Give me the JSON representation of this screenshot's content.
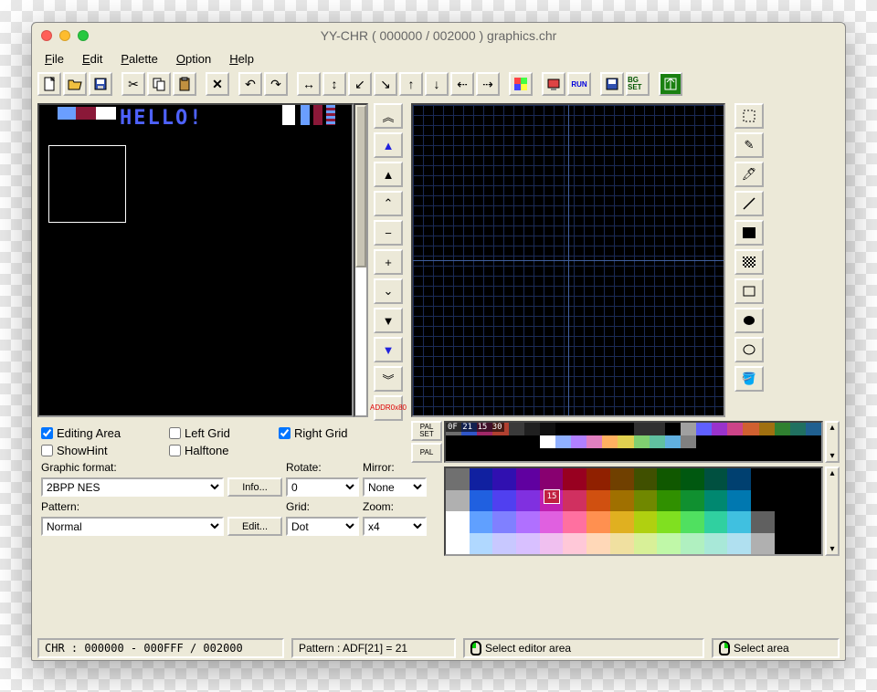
{
  "title": "YY-CHR ( 000000 / 002000 ) graphics.chr",
  "menu": {
    "file": "File",
    "edit": "Edit",
    "palette": "Palette",
    "option": "Option",
    "help": "Help"
  },
  "toolbar": {
    "new": "new",
    "open": "open",
    "save": "save",
    "cut": "cut",
    "copy": "copy",
    "paste": "paste",
    "delete": "delete",
    "undo": "undo",
    "redo": "redo",
    "fliph": "fliph",
    "flipv": "flipv",
    "rotl": "rotl",
    "rotr": "rotr",
    "shu": "shift-up",
    "shd": "shift-down",
    "shl": "shift-left",
    "shr": "shift-right",
    "pal": "palette",
    "emu": "emulator",
    "run": "RUN",
    "save2": "save",
    "bgset": "BG SET",
    "exit": "exit"
  },
  "nav": {
    "addr_label": "ADDR",
    "addr_value": "0x80"
  },
  "chr": {
    "hello": "HELLO!"
  },
  "checks": {
    "editing_area": "Editing Area",
    "left_grid": "Left Grid",
    "right_grid": "Right Grid",
    "showhint": "ShowHint",
    "halftone": "Halftone"
  },
  "opts": {
    "graphic_format_label": "Graphic format:",
    "graphic_format_value": "2BPP NES",
    "info_btn": "Info...",
    "rotate_label": "Rotate:",
    "rotate_value": "0",
    "mirror_label": "Mirror:",
    "mirror_value": "None",
    "pattern_label": "Pattern:",
    "pattern_value": "Normal",
    "edit_btn": "Edit...",
    "grid_label": "Grid:",
    "grid_value": "Dot",
    "zoom_label": "Zoom:",
    "zoom_value": "x4"
  },
  "pal": {
    "set": "PAL SET",
    "pal": "PAL",
    "nums": "0F 21 15 30",
    "marker": "15"
  },
  "palette_colors": [
    "#6d6d6d",
    "#3056c8",
    "#a02868",
    "#b04030",
    "#3a3a3a",
    "#202020",
    "#101010",
    "#000",
    "#000",
    "#000",
    "#000",
    "#000",
    "#303030",
    "#303030",
    "#000",
    "#a0a0a0",
    "#6060ff",
    "#9933cc",
    "#cc4488",
    "#d06030",
    "#a07010",
    "#308030",
    "#207060",
    "#206090",
    "#000",
    "#000",
    "#000",
    "#000",
    "#000",
    "#000",
    "#fff",
    "#90b0ff",
    "#b080ff",
    "#e080c0",
    "#ffb060",
    "#e0d050",
    "#80d070",
    "#60c0a0",
    "#60b0e0",
    "#808080",
    "#000",
    "#000",
    "#000",
    "#000",
    "#000",
    "#000",
    "#000",
    "#000",
    "#000",
    "#000",
    "#000",
    "#000",
    "#000",
    "#000",
    "#000",
    "#000",
    "#000",
    "#000",
    "#000",
    "#000",
    "#000",
    "#000",
    "#000",
    "#000",
    "#000",
    "#000",
    "#000",
    "#000",
    "#000",
    "#000",
    "#000",
    "#000"
  ],
  "gradient_colors": [
    "#707070",
    "#1020a0",
    "#3010b0",
    "#6000a0",
    "#880070",
    "#980020",
    "#902000",
    "#704000",
    "#405000",
    "#105800",
    "#005810",
    "#005040",
    "#004070",
    "#000",
    "#000",
    "#000",
    "#b0b0b0",
    "#2060e0",
    "#5040f0",
    "#8030e0",
    "#c020b0",
    "#d03060",
    "#d05010",
    "#a07000",
    "#708800",
    "#309000",
    "#109030",
    "#008870",
    "#0078b0",
    "#000",
    "#000",
    "#000",
    "#fff",
    "#60a0ff",
    "#8080ff",
    "#b070ff",
    "#e060e0",
    "#ff70a0",
    "#ff9050",
    "#e0b020",
    "#b0d010",
    "#80e020",
    "#50e060",
    "#30d0a0",
    "#40c0e0",
    "#606060",
    "#000",
    "#000",
    "#fff",
    "#b0d8ff",
    "#c8c8ff",
    "#d8c0ff",
    "#f0c0f0",
    "#ffc8d8",
    "#ffd8b8",
    "#f0e0a0",
    "#d8f098",
    "#c0f8a8",
    "#b0f0c0",
    "#a8e8d8",
    "#b0e0f0",
    "#b0b0b0",
    "#000",
    "#000"
  ],
  "status": {
    "chr": "CHR : 000000 - 000FFF / 002000",
    "pattern": "Pattern : ADF[21] = 21",
    "sel_editor": "Select editor area",
    "sel_area": "Select area"
  }
}
